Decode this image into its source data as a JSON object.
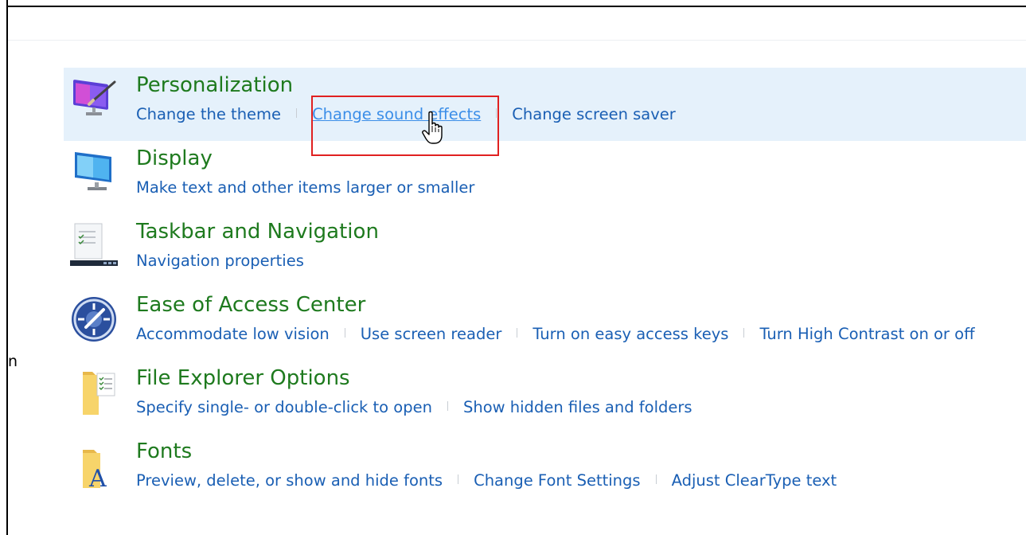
{
  "left_stub": "n",
  "categories": [
    {
      "title": "Personalization",
      "icon": "personalization-icon",
      "links": [
        "Change the theme",
        "Change sound effects",
        "Change screen saver"
      ]
    },
    {
      "title": "Display",
      "icon": "display-icon",
      "links": [
        "Make text and other items larger or smaller"
      ]
    },
    {
      "title": "Taskbar and Navigation",
      "icon": "taskbar-icon",
      "links": [
        "Navigation properties"
      ]
    },
    {
      "title": "Ease of Access Center",
      "icon": "ease-of-access-icon",
      "links": [
        "Accommodate low vision",
        "Use screen reader",
        "Turn on easy access keys",
        "Turn High Contrast on or off"
      ]
    },
    {
      "title": "File Explorer Options",
      "icon": "folder-options-icon",
      "links": [
        "Specify single- or double-click to open",
        "Show hidden files and folders"
      ]
    },
    {
      "title": "Fonts",
      "icon": "fonts-icon",
      "links": [
        "Preview, delete, or show and hide fonts",
        "Change Font Settings",
        "Adjust ClearType text"
      ]
    }
  ],
  "colors": {
    "title_green": "#1e7a1e",
    "link_blue": "#1a5fb4",
    "hover_link_blue": "#3b8ee8",
    "hover_bg": "#e5f1fb",
    "highlight_red": "#e02020"
  }
}
